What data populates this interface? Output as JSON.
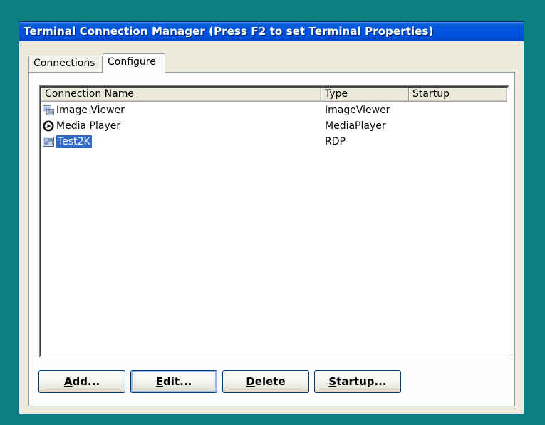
{
  "window": {
    "title": "Terminal Connection Manager (Press F2 to set Terminal Properties)"
  },
  "tabs": [
    {
      "label": "Connections",
      "selected": false
    },
    {
      "label": "Configure",
      "selected": true
    }
  ],
  "list": {
    "columns": [
      "Connection Name",
      "Type",
      "Startup"
    ],
    "rows": [
      {
        "name": "Image Viewer",
        "type": "ImageViewer",
        "startup": "",
        "icon": "image-viewer-icon",
        "selected": false
      },
      {
        "name": "Media Player",
        "type": "MediaPlayer",
        "startup": "",
        "icon": "media-player-icon",
        "selected": false
      },
      {
        "name": "Test2K",
        "type": "RDP",
        "startup": "",
        "icon": "rdp-icon",
        "selected": true
      }
    ]
  },
  "buttons": {
    "add": {
      "accel": "A",
      "rest": "dd..."
    },
    "edit": {
      "accel": "E",
      "rest": "dit..."
    },
    "delete": {
      "accel": "D",
      "rest": "elete"
    },
    "startup": {
      "accel": "S",
      "rest": "tartup..."
    }
  },
  "colors": {
    "desktop": "#0a8085",
    "titlebar": "#0054e3",
    "selection": "#316ac5"
  }
}
